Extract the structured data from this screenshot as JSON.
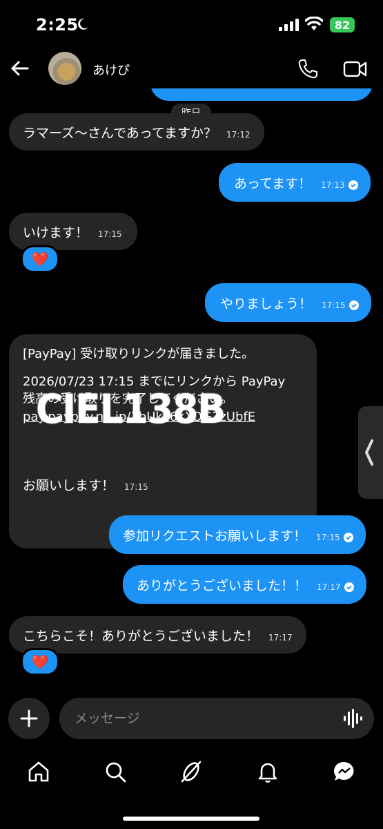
{
  "status_bar": {
    "time": "2:25",
    "battery": "82"
  },
  "header": {
    "contact_name": "あけぴ"
  },
  "chat": {
    "date_separator": "昨日",
    "messages": [
      {
        "direction": "in",
        "text": "ラマーズ〜さんであってますか？",
        "time": "17:12",
        "read": false
      },
      {
        "direction": "out",
        "text": "あってます！",
        "time": "17:13",
        "read": true
      },
      {
        "direction": "in",
        "text": "いけます！",
        "time": "17:15",
        "read": false,
        "reaction": "❤️"
      },
      {
        "direction": "out",
        "text": "やりましょう！",
        "time": "17:15",
        "read": true
      },
      {
        "direction": "in",
        "text": "お願いします！",
        "time": "17:15",
        "read": false
      },
      {
        "direction": "out",
        "text": "参加リクエストお願いします！",
        "time": "17:15",
        "read": true
      },
      {
        "direction": "out",
        "text": "ありがとうございました！！",
        "time": "17:17",
        "read": true
      },
      {
        "direction": "in",
        "text": "こちらこそ！ありがとうございました！",
        "time": "17:17",
        "read": false,
        "reaction": "❤️"
      }
    ],
    "paypay": {
      "line1": "[PayPay] 受け取りリンクが届きました。",
      "line2": "2026/07/23 17:15 までにリンクから PayPay",
      "line3": "残高の受け取りを完了してください。",
      "link": "pay.paypay.ne.jp/3bUkc6kXOG3zUbfE"
    },
    "watermark": "CIEL138B"
  },
  "composer": {
    "placeholder": "メッセージ"
  },
  "colors": {
    "background": "#000000",
    "incoming_bubble": "#262626",
    "outgoing_bubble": "#1d93f5",
    "battery": "#34c759",
    "heart": "#ff2d3d"
  },
  "icons": {
    "back": "arrow-left-icon",
    "phone": "phone-icon",
    "video": "video-camera-icon",
    "add": "plus-icon",
    "voice": "waveform-icon",
    "tabs": [
      "home-icon",
      "search-icon",
      "explore-icon",
      "bell-icon",
      "messages-icon"
    ]
  }
}
